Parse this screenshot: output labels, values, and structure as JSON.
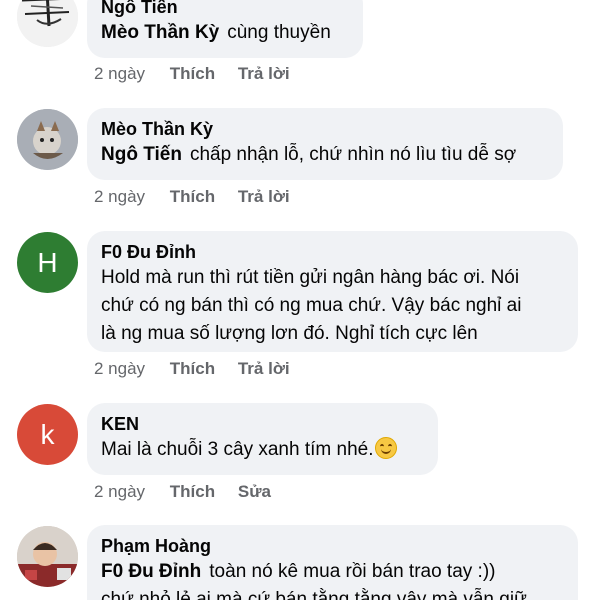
{
  "comments": [
    {
      "author": "Ngô Tiến",
      "mention": "Mèo Thần Kỳ",
      "text": "cùng thuyền",
      "time": "2 ngày",
      "like": "Thích",
      "action2": "Trả lời",
      "avatar_icon": "drawing-avatar-icon"
    },
    {
      "author": "Mèo Thần Kỳ",
      "mention": "Ngô Tiến",
      "text": "chấp nhận lỗ, chứ nhìn nó lìu tìu dễ sợ",
      "time": "2 ngày",
      "like": "Thích",
      "action2": "Trả lời",
      "avatar_icon": "cat-avatar-icon"
    },
    {
      "author": "F0 Đu Đỉnh",
      "lines": [
        "Hold mà run thì rút tiền gửi ngân hàng bác ơi. Nói",
        "chứ có ng bán thì có ng mua chứ. Vậy bác nghỉ ai",
        "là ng mua số lượng lơn đó. Nghỉ tích cực lên"
      ],
      "time": "2 ngày",
      "like": "Thích",
      "action2": "Trả lời",
      "avatar_letter": "H",
      "avatar_color": "#2e7d32"
    },
    {
      "author": "KEN",
      "text": "Mai là chuỗi 3 cây xanh tím nhé.",
      "emoji": "smiling-face-emoji",
      "time": "2 ngày",
      "like": "Thích",
      "action2": "Sửa",
      "avatar_letter": "k",
      "avatar_color": "#d84a38"
    },
    {
      "author": "Phạm Hoàng",
      "mention": "F0 Đu Đỉnh",
      "text": "toàn nó kê mua rồi bán trao tay :))",
      "line2": "chứ nhỏ lẻ ai mà cứ bán tằng tằng vậy mà vẫn giữ",
      "avatar_icon": "child-photo-avatar-icon"
    }
  ]
}
